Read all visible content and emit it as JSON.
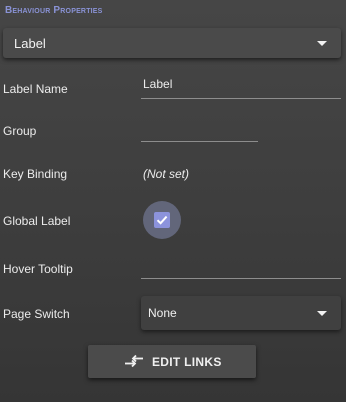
{
  "panel": {
    "title": "Behaviour Properties"
  },
  "type_select": {
    "value": "Label"
  },
  "fields": {
    "label_name": {
      "label": "Label Name",
      "value": "Label"
    },
    "group": {
      "label": "Group",
      "value": ""
    },
    "key_binding": {
      "label": "Key Binding",
      "value": "(Not set)"
    },
    "global_label": {
      "label": "Global Label",
      "checked": true
    },
    "hover_tooltip": {
      "label": "Hover Tooltip",
      "value": ""
    },
    "page_switch": {
      "label": "Page Switch",
      "value": "None"
    }
  },
  "edit_links": {
    "label": "EDIT LINKS",
    "icon": "swap-arrows-icon"
  },
  "colors": {
    "accent": "#8c93dc",
    "title": "#8a93d6"
  }
}
